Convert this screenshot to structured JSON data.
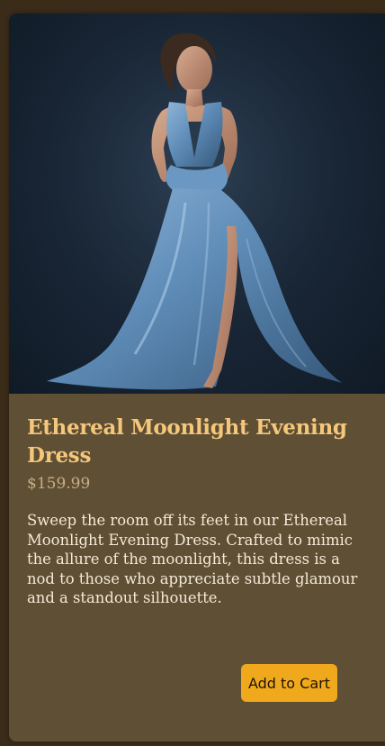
{
  "product": {
    "image_alt": "Model wearing a flowing light blue satin evening gown against a dark background",
    "title": "Ethereal Moonlight Evening Dress",
    "price": "$159.99",
    "description": "Sweep the room off its feet in our Ethereal Moonlight Evening Dress. Crafted to mimic the allure of the moonlight, this dress is a nod to those who appreciate subtle glamour and a standout silhouette.",
    "add_to_cart_label": "Add to Cart"
  },
  "colors": {
    "page_background": "#3b2c19",
    "card_background": "#5f4f34",
    "title": "#f5c77b",
    "price": "#c8ae84",
    "description": "#f4ead8",
    "button": "#f0a91d"
  }
}
